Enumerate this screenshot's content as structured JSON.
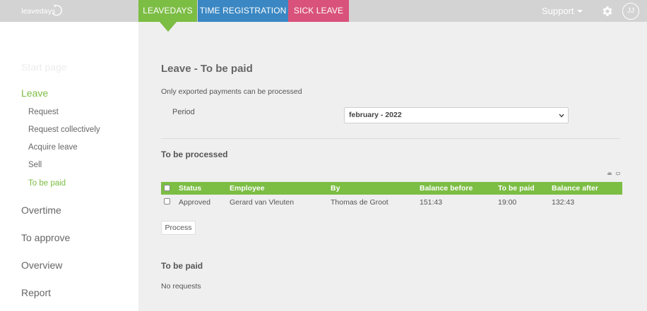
{
  "app": {
    "logo_text": "leavedays"
  },
  "nav": {
    "tabs": [
      {
        "label": "LEAVEDAYS",
        "color": "#7cbd44",
        "active": true
      },
      {
        "label": "TIME REGISTRATION",
        "color": "#3a87c3",
        "active": false
      },
      {
        "label": "SICK LEAVE",
        "color": "#d9527b",
        "active": false
      }
    ],
    "support_label": "Support",
    "settings_icon": "gear-icon",
    "user_initials": "JJ"
  },
  "sidebar": {
    "faded_item": "Start page",
    "sections": [
      {
        "label": "Leave",
        "active": true
      },
      {
        "label": "Overtime"
      },
      {
        "label": "To approve"
      },
      {
        "label": "Overview"
      },
      {
        "label": "Report"
      }
    ],
    "leave_items": [
      {
        "label": "Request"
      },
      {
        "label": "Request collectively"
      },
      {
        "label": "Acquire leave"
      },
      {
        "label": "Sell"
      },
      {
        "label": "To be paid",
        "active": true
      }
    ]
  },
  "main": {
    "title": "Leave - To be paid",
    "notice": "Only exported payments can be processed",
    "period": {
      "label": "Period",
      "selected": "february - 2022"
    },
    "to_be_processed": {
      "heading": "To be processed",
      "columns": [
        "Status",
        "Employee",
        "By",
        "Balance before",
        "To be paid",
        "Balance after"
      ],
      "rows": [
        {
          "status": "Approved",
          "employee": "Gerard van Vleuten",
          "by": "Thomas de Groot",
          "balance_before": "151:43",
          "to_be_paid": "19:00",
          "balance_after": "132:43"
        }
      ],
      "process_button": "Process"
    },
    "to_be_paid": {
      "heading": "To be paid",
      "empty_text": "No requests"
    }
  },
  "colors": {
    "accent_green": "#7cbd44",
    "blue": "#3a87c3",
    "pink": "#d9527b",
    "topbar_gray": "#d3d3d3"
  }
}
